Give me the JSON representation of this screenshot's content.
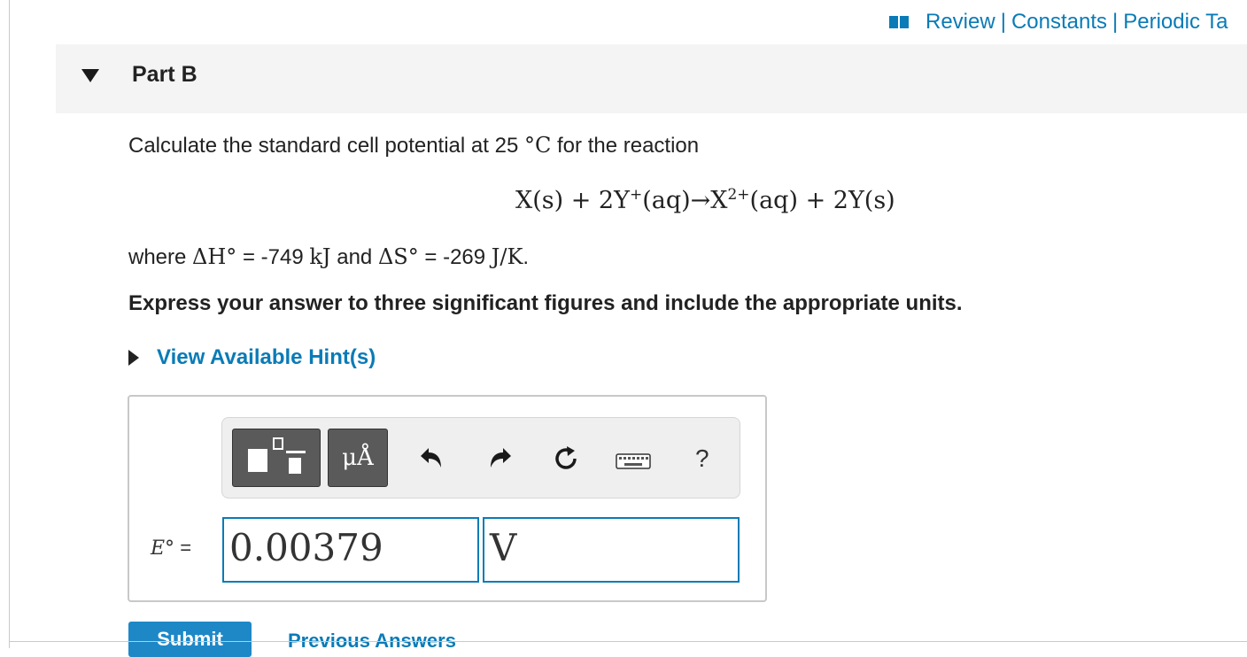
{
  "topbar": {
    "review": "Review",
    "separator": "|",
    "constants": "Constants",
    "periodic": "Periodic Ta"
  },
  "part": {
    "title": "Part B"
  },
  "question": {
    "intro": "Calculate the standard cell potential at 25",
    "temp_unit": "°C",
    "intro_tail": "for the reaction",
    "reaction": {
      "lhs": "X(s) + 2Y",
      "lhs_sup": "+",
      "mid": "(aq)→X",
      "mid_sup": "2+",
      "rhs": "(aq) + 2Y(s)"
    },
    "where": "where",
    "dH_symbol": "ΔH°",
    "dH_value": "= -749",
    "dH_unit": "kJ",
    "and": "and",
    "dS_symbol": "ΔS°",
    "dS_value": "= -269",
    "dS_unit": "J/K",
    "period": ".",
    "instructions": "Express your answer to three significant figures and include the appropriate units."
  },
  "hint": {
    "label": "View Available Hint(s)"
  },
  "toolbar": {
    "units_label": "μÅ",
    "help_label": "?"
  },
  "answer": {
    "variable": "E°",
    "equals": "=",
    "value": "0.00379",
    "unit": "V"
  },
  "actions": {
    "submit": "Submit",
    "previous": "Previous Answers"
  },
  "colors": {
    "link": "#0a7bb7",
    "submit_bg": "#1e88c7",
    "button_dark": "#5a5a5a"
  }
}
